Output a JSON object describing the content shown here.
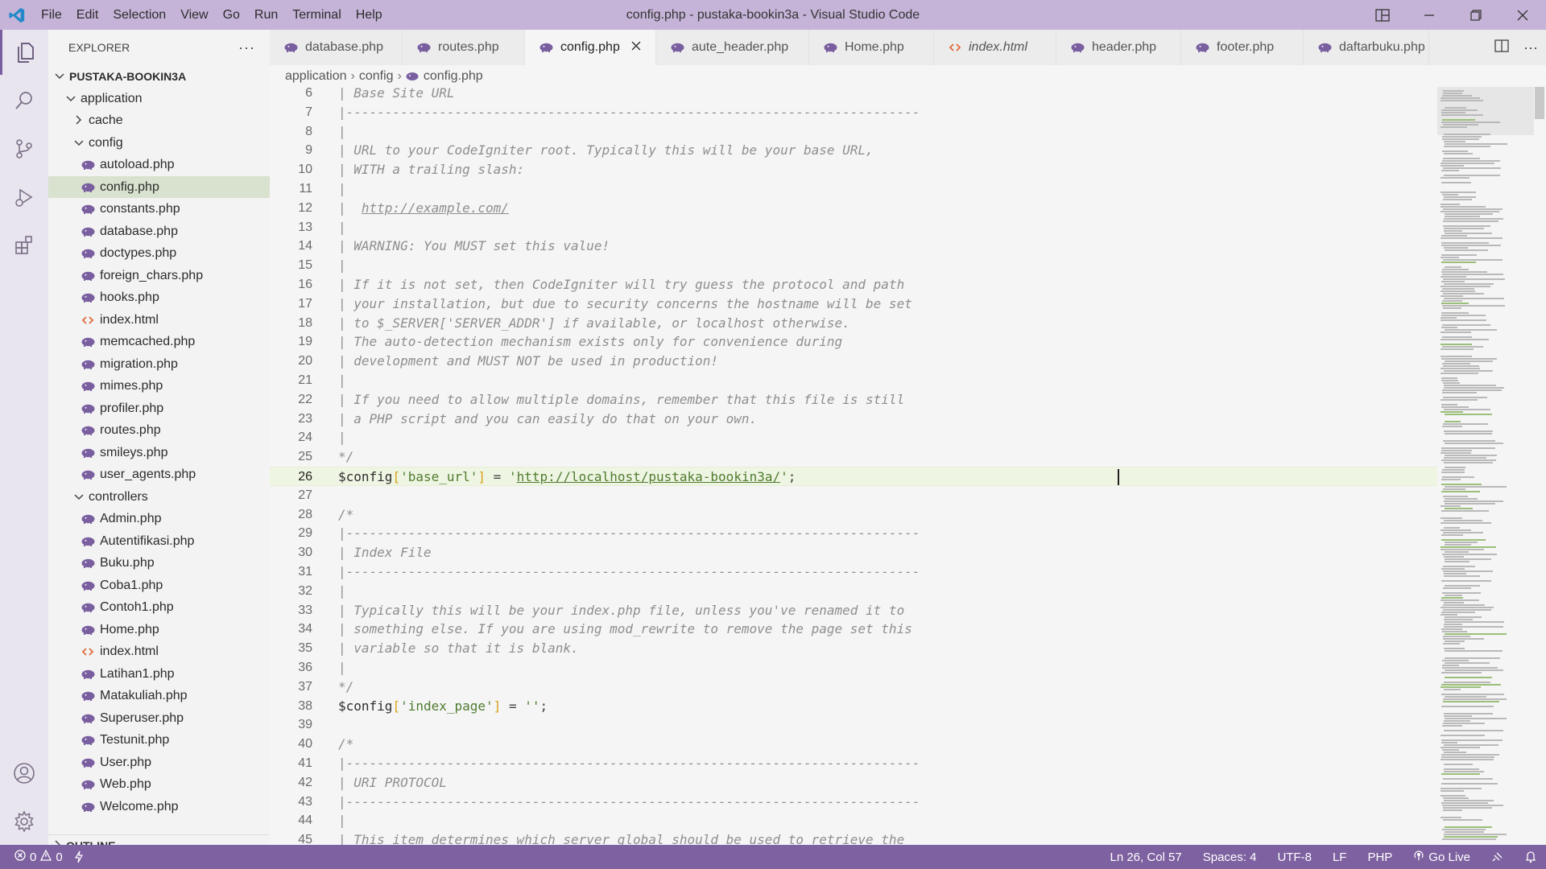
{
  "window": {
    "title": "config.php - pustaka-bookin3a - Visual Studio Code",
    "menu": [
      "File",
      "Edit",
      "Selection",
      "View",
      "Go",
      "Run",
      "Terminal",
      "Help"
    ]
  },
  "sidebar": {
    "header": "EXPLORER",
    "more": "···",
    "root": "PUSTAKA-BOOKIN3A",
    "folder_application": "application",
    "folder_cache": "cache",
    "folder_config": "config",
    "config_files": [
      "autoload.php",
      "config.php",
      "constants.php",
      "database.php",
      "doctypes.php",
      "foreign_chars.php",
      "hooks.php",
      "index.html",
      "memcached.php",
      "migration.php",
      "mimes.php",
      "profiler.php",
      "routes.php",
      "smileys.php",
      "user_agents.php"
    ],
    "folder_controllers": "controllers",
    "controller_files": [
      "Admin.php",
      "Autentifikasi.php",
      "Buku.php",
      "Coba1.php",
      "Contoh1.php",
      "Home.php",
      "index.html",
      "Latihan1.php",
      "Matakuliah.php",
      "Superuser.php",
      "Testunit.php",
      "User.php",
      "Web.php",
      "Welcome.php"
    ],
    "outline": "OUTLINE"
  },
  "tabs": [
    {
      "label": "database.php"
    },
    {
      "label": "routes.php"
    },
    {
      "label": "config.php"
    },
    {
      "label": "aute_header.php"
    },
    {
      "label": "Home.php"
    },
    {
      "label": "index.html"
    },
    {
      "label": "header.php"
    },
    {
      "label": "footer.php"
    },
    {
      "label": "daftarbuku.php"
    }
  ],
  "breadcrumb": [
    "application",
    "config",
    "config.php"
  ],
  "editor": {
    "line_numbers": [
      "6",
      "7",
      "8",
      "9",
      "10",
      "11",
      "12",
      "13",
      "14",
      "15",
      "16",
      "17",
      "18",
      "19",
      "20",
      "21",
      "22",
      "23",
      "24",
      "25",
      "26",
      "27",
      "28",
      "29",
      "30",
      "31",
      "32",
      "33",
      "34",
      "35",
      "36",
      "37",
      "38",
      "39",
      "40",
      "41",
      "42",
      "43",
      "44",
      "45"
    ],
    "comment_lines": {
      "6": "| Base Site URL",
      "7": "|--------------------------------------------------------------------------",
      "8": "|",
      "9": "| URL to your CodeIgniter root. Typically this will be your base URL,",
      "10": "| WITH a trailing slash:",
      "11": "|",
      "12a": "|  ",
      "12b": "http://example.com/",
      "13": "|",
      "14": "| WARNING: You MUST set this value!",
      "15": "|",
      "16": "| If it is not set, then CodeIgniter will try guess the protocol and path",
      "17": "| your installation, but due to security concerns the hostname will be set",
      "18": "| to $_SERVER['SERVER_ADDR'] if available, or localhost otherwise.",
      "19": "| The auto-detection mechanism exists only for convenience during",
      "20": "| development and MUST NOT be used in production!",
      "21": "|",
      "22": "| If you need to allow multiple domains, remember that this file is still",
      "23": "| a PHP script and you can easily do that on your own.",
      "24": "|",
      "25": "*/",
      "27": "",
      "28": "/*",
      "29": "|--------------------------------------------------------------------------",
      "30": "| Index File",
      "31": "|--------------------------------------------------------------------------",
      "32": "|",
      "33": "| Typically this will be your index.php file, unless you've renamed it to",
      "34": "| something else. If you are using mod_rewrite to remove the page set this",
      "35": "| variable so that it is blank.",
      "36": "|",
      "37": "*/",
      "39": "",
      "40": "/*",
      "41": "|--------------------------------------------------------------------------",
      "42": "| URI PROTOCOL",
      "43": "|--------------------------------------------------------------------------",
      "44": "|",
      "45": "| This item determines which server global should be used to retrieve the"
    },
    "line26": {
      "var": "$config",
      "b1": "[",
      "key": "'base_url'",
      "b2": "]",
      "op": " = ",
      "q1": "'",
      "url": "http://localhost/pustaka-bookin3a/",
      "q2": "'",
      "end": ";"
    },
    "line38": {
      "var": "$config",
      "b1": "[",
      "key": "'index_page'",
      "b2": "]",
      "op": " = ",
      "val": "''",
      "end": ";"
    }
  },
  "status": {
    "errors": "0",
    "warnings": "0",
    "position": "Ln 26, Col 57",
    "spaces": "Spaces: 4",
    "encoding": "UTF-8",
    "eol": "LF",
    "language": "PHP",
    "golive": "Go Live"
  },
  "colors": {
    "titlebar": "#c5b4d8",
    "statusbar": "#7e61a0",
    "php_icon": "#7a5fa0",
    "html_icon": "#e06a3b",
    "string": "#4f7b2f",
    "bracket": "#d8a317"
  }
}
